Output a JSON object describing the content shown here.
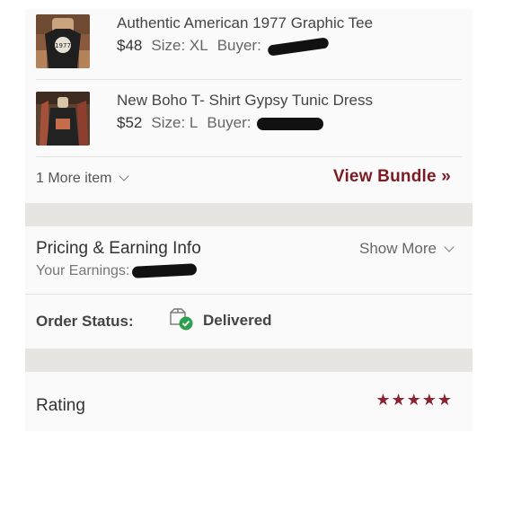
{
  "items": [
    {
      "title": "Authentic American 1977 Graphic Tee",
      "price": "$48",
      "size": "Size: XL",
      "buyer_label": "Buyer:"
    },
    {
      "title": "New Boho T- Shirt Gypsy Tunic Dress",
      "price": "$52",
      "size": "Size: L",
      "buyer_label": "Buyer:"
    }
  ],
  "bundle": {
    "more_items": "1 More item",
    "view_bundle": "View Bundle »"
  },
  "pricing": {
    "title": "Pricing & Earning Info",
    "earnings_label": "Your Earnings:",
    "show_more": "Show More"
  },
  "order": {
    "label": "Order Status:",
    "value": "Delivered",
    "icon": "delivered-box-icon"
  },
  "rating": {
    "label": "Rating",
    "stars": "★★★★★",
    "value": 5,
    "max": 5
  },
  "colors": {
    "accent": "#7b1c24",
    "star": "#8b2430",
    "check": "#2e9e4f",
    "band": "#e6e5e2"
  }
}
